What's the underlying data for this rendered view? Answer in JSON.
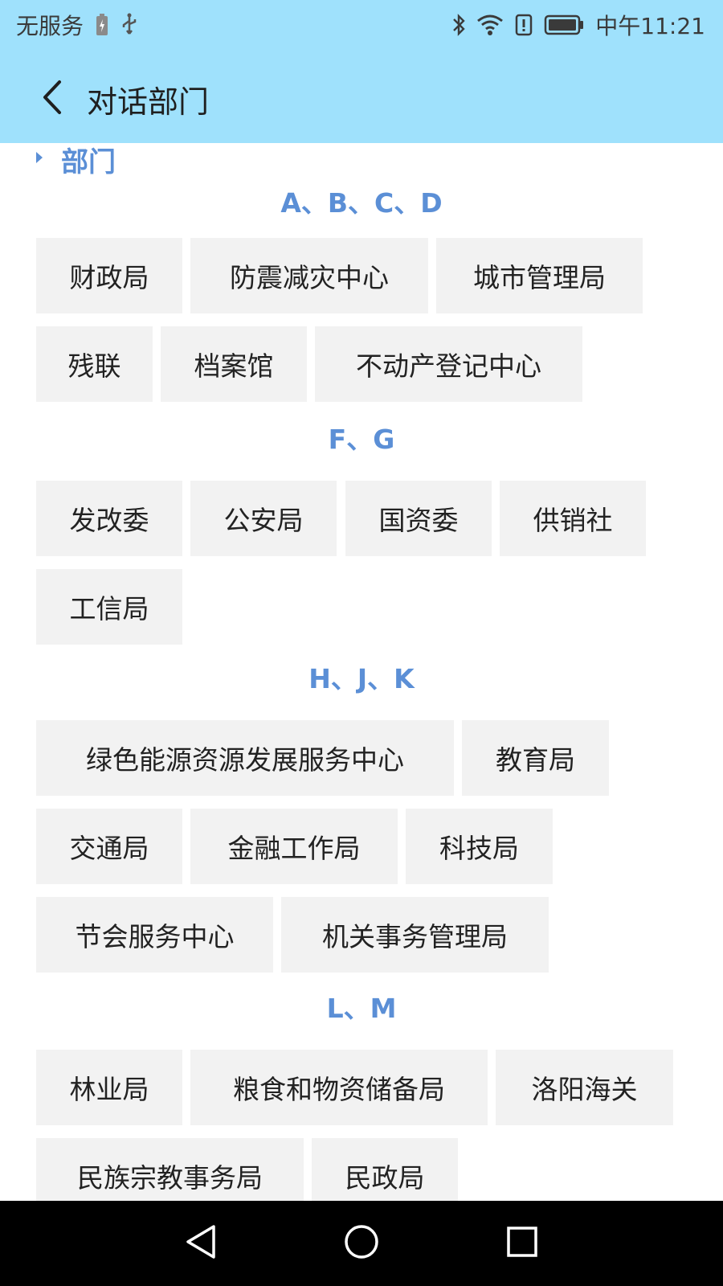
{
  "status_bar": {
    "carrier": "无服务",
    "time": "中午11:21",
    "icons": [
      "battery-charging-icon",
      "usb-icon",
      "bluetooth-icon",
      "wifi-icon",
      "alert-icon",
      "battery-icon"
    ]
  },
  "header": {
    "title": "对话部门",
    "back_icon": "chevron-left-icon"
  },
  "section": {
    "title": "部门",
    "icon": "triangle-right-icon"
  },
  "groups": [
    {
      "letters": "A、B、C、D",
      "items": [
        "财政局",
        "防震减灾中心",
        "城市管理局",
        "残联",
        "档案馆",
        "不动产登记中心"
      ]
    },
    {
      "letters": "F、G",
      "items": [
        "发改委",
        "公安局",
        "国资委",
        "供销社",
        "工信局"
      ]
    },
    {
      "letters": "H、J、K",
      "items": [
        "绿色能源资源发展服务中心",
        "教育局",
        "交通局",
        "金融工作局",
        "科技局",
        "节会服务中心",
        "机关事务管理局"
      ]
    },
    {
      "letters": "L、M",
      "items": [
        "林业局",
        "粮食和物资储备局",
        "洛阳海关",
        "民族宗教事务局",
        "民政局"
      ]
    }
  ],
  "nav_bar": {
    "back": "triangle-back-icon",
    "home": "circle-home-icon",
    "recents": "square-recents-icon"
  },
  "colors": {
    "header_bg": "#9fe1fc",
    "accent": "#5b8fd6",
    "chip_bg": "#f2f2f2",
    "nav_bg": "#000000"
  }
}
